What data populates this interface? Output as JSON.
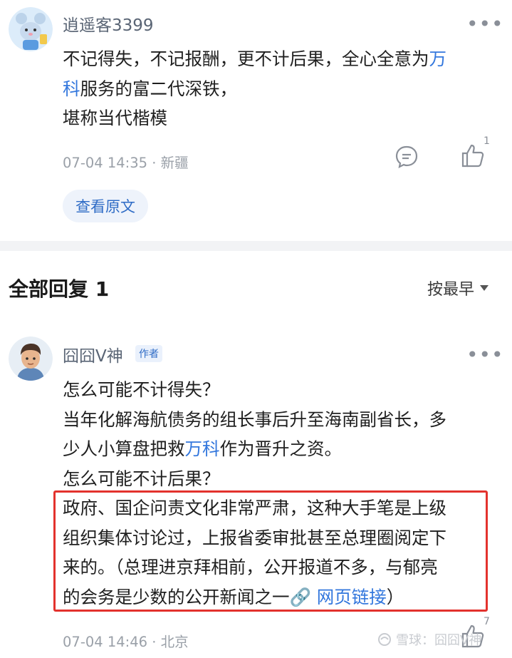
{
  "comment": {
    "username": "逍遥客3399",
    "text_lines": [
      {
        "pre": "不记得失，不记报酬，更不计后果，全心全意为",
        "link": "万",
        "post": ""
      },
      {
        "pre": "",
        "link": "科",
        "post": "服务的富二代深铁，"
      },
      {
        "pre": "堪称当代楷模",
        "link": "",
        "post": ""
      }
    ],
    "time": "07-04 14:35",
    "location": "新疆",
    "like_count": "1",
    "view_original_label": "查看原文"
  },
  "replies_header": {
    "title": "全部回复 1",
    "sort_label": "按最早"
  },
  "reply": {
    "username": "囧囧V神",
    "badge": "作者",
    "lines": [
      {
        "pre": "怎么可能不计得失？",
        "link": "",
        "post": ""
      },
      {
        "pre": "当年化解海航债务的组长事后升至海南副省长，多",
        "link": "",
        "post": ""
      },
      {
        "pre": "少人小算盘把救",
        "link": "万科",
        "post": "作为晋升之资。"
      },
      {
        "pre": "怎么可能不计后果？",
        "link": "",
        "post": ""
      },
      {
        "pre": "政府、国企问责文化非常严肃，这种大手笔是上级",
        "link": "",
        "post": ""
      },
      {
        "pre": "组织集体讨论过，上报省委审批甚至总理圈阅定下",
        "link": "",
        "post": ""
      },
      {
        "pre": "来的。（总理进京拜相前，公开报道不多，与郁亮",
        "link": "",
        "post": ""
      },
      {
        "pre": "的会务是少数的公开新闻之一",
        "link": "🔗 网页链接",
        "post": "）"
      }
    ],
    "time": "07-04 14:46",
    "location": "北京",
    "like_count": "7"
  },
  "watermark": "雪球：囧囧V神",
  "colors": {
    "link": "#3377dd",
    "highlight_box": "#e3322d",
    "badge_bg": "#eaf1fc"
  }
}
